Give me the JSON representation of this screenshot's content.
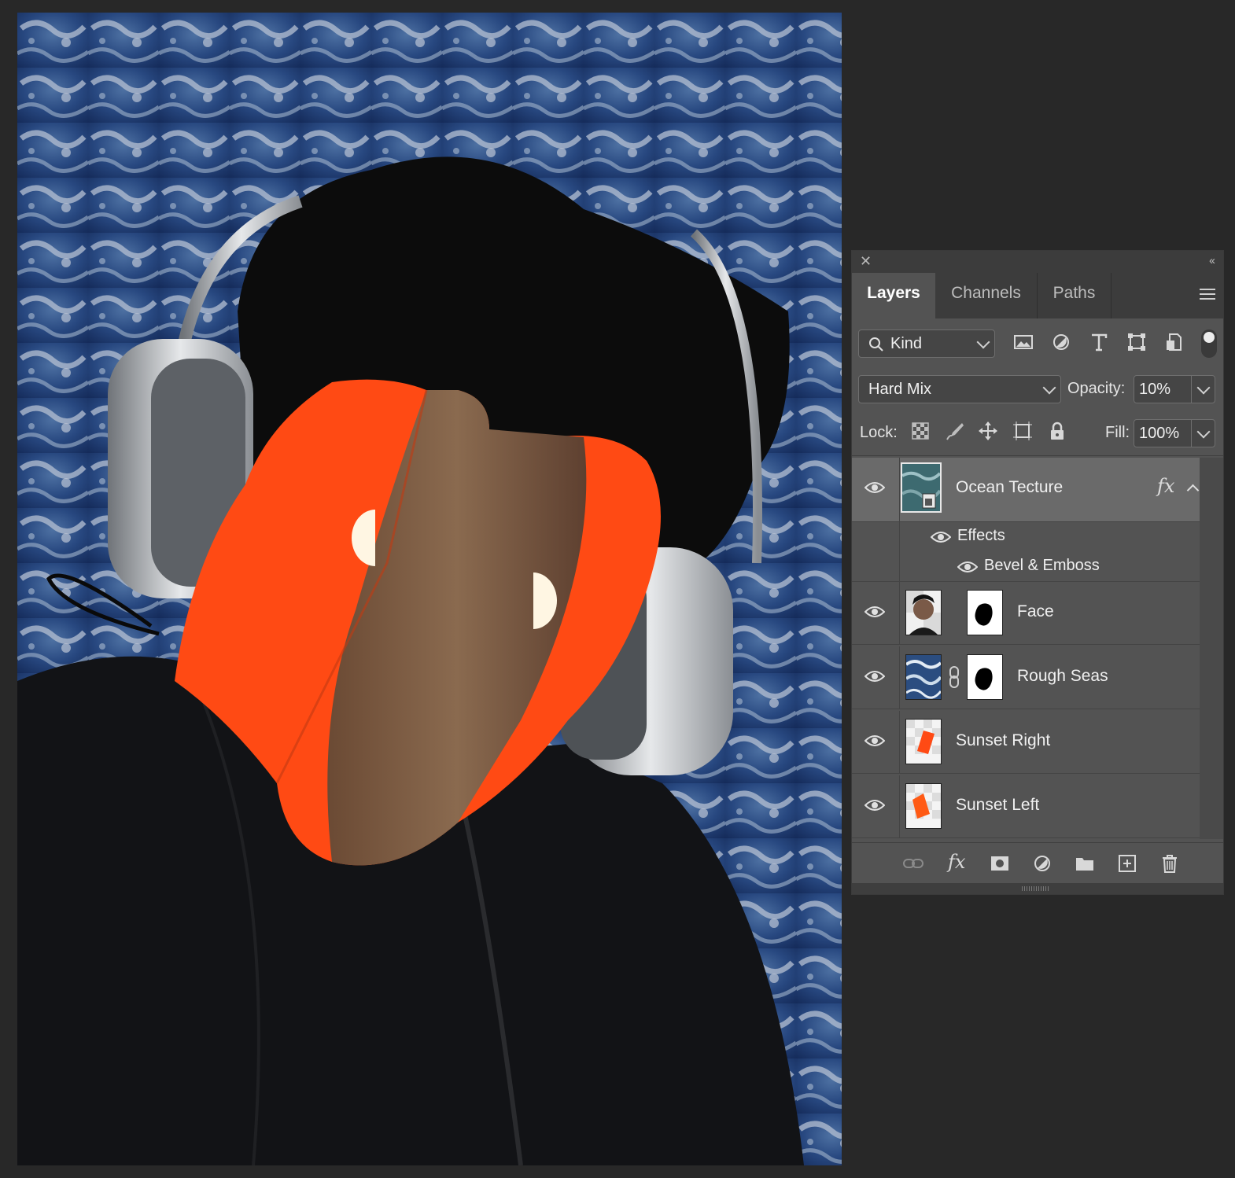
{
  "panel": {
    "tabs": [
      {
        "label": "Layers",
        "active": true
      },
      {
        "label": "Channels",
        "active": false
      },
      {
        "label": "Paths",
        "active": false
      }
    ],
    "filter": {
      "kind_label": "Kind"
    },
    "blend": {
      "mode": "Hard Mix",
      "opacity_label": "Opacity:",
      "opacity_value": "10%"
    },
    "lock": {
      "label": "Lock:",
      "fill_label": "Fill:",
      "fill_value": "100%"
    },
    "layers": [
      {
        "name": "Ocean Tecture",
        "selected": true,
        "has_fx": true,
        "effects_label": "Effects",
        "effects": [
          "Bevel & Emboss"
        ]
      },
      {
        "name": "Face",
        "has_mask": true
      },
      {
        "name": "Rough Seas",
        "has_mask": true,
        "linked": true
      },
      {
        "name": "Sunset Right"
      },
      {
        "name": "Sunset Left"
      }
    ]
  },
  "colors": {
    "panel_bg": "#535353",
    "selected_row": "#6a6a6a",
    "sunset_orange": "#ff4a14",
    "ocean_blue": "#1d3a6b"
  },
  "icons": [
    "close-icon",
    "collapse-icon",
    "panel-menu-icon",
    "search-icon",
    "image-filter-icon",
    "adjustment-filter-icon",
    "type-filter-icon",
    "shape-filter-icon",
    "smart-object-filter-icon",
    "eye-icon",
    "link-icon",
    "fx-icon",
    "mask-icon",
    "adjustment-icon",
    "folder-icon",
    "new-layer-icon",
    "trash-icon"
  ]
}
